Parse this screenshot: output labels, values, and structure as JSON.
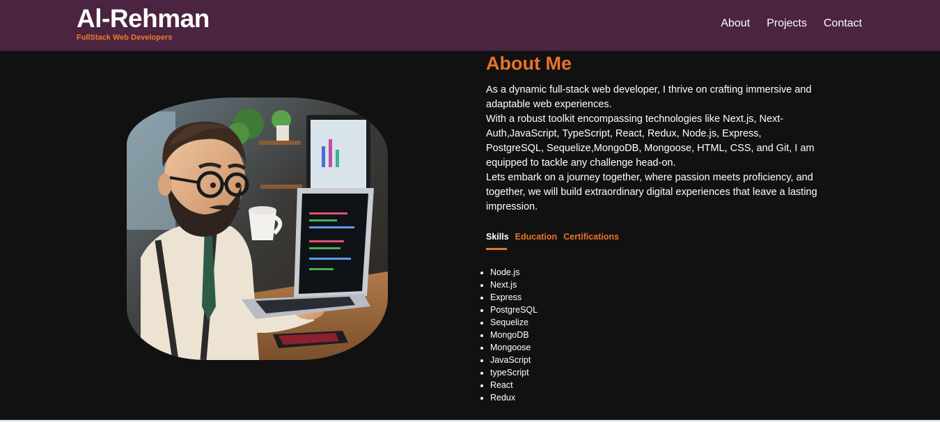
{
  "brand": {
    "title": "Al-Rehman",
    "subtitle": "FullStack Web Developers"
  },
  "nav": {
    "links": [
      "About",
      "Projects",
      "Contact"
    ]
  },
  "about": {
    "title": "About Me",
    "paragraphs": [
      "As a dynamic full-stack web developer, I thrive on crafting immersive and adaptable web experiences.",
      "With a robust toolkit encompassing technologies like Next.js, Next-Auth,JavaScript, TypeScript, React, Redux, Node.js, Express, PostgreSQL, Sequelize,MongoDB, Mongoose, HTML, CSS, and Git, I am equipped to tackle any challenge head-on.",
      "Lets embark on a journey together, where passion meets proficiency, and together, we will build extraordinary digital experiences that leave a lasting impression."
    ]
  },
  "tabs": [
    {
      "label": "Skills",
      "active": true
    },
    {
      "label": "Education",
      "active": false
    },
    {
      "label": "Certifications",
      "active": false
    }
  ],
  "skills": [
    "Node.js",
    "Next.js",
    "Express",
    "PostgreSQL",
    "Sequelize",
    "MongoDB",
    "Mongoose",
    "JavaScript",
    "typeScript",
    "React",
    "Redux"
  ],
  "colors": {
    "navbar": "#4a2440",
    "accent": "#e8742a",
    "background": "#111111"
  }
}
